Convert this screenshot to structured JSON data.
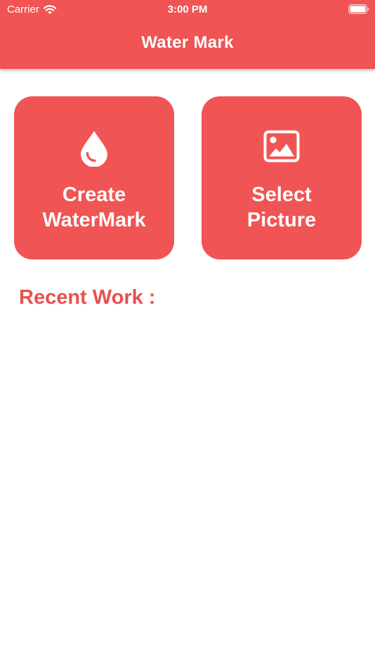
{
  "status_bar": {
    "carrier": "Carrier",
    "time": "3:00 PM"
  },
  "header": {
    "title": "Water Mark"
  },
  "actions": {
    "create": {
      "line1": "Create",
      "line2": "WaterMark",
      "icon": "water-drop-icon"
    },
    "select": {
      "line1": "Select",
      "line2": "Picture",
      "icon": "image-icon"
    }
  },
  "recent": {
    "title": "Recent Work :"
  },
  "colors": {
    "primary": "#F05454",
    "on_primary": "#FFFFFF",
    "recent_title": "#E85050"
  }
}
